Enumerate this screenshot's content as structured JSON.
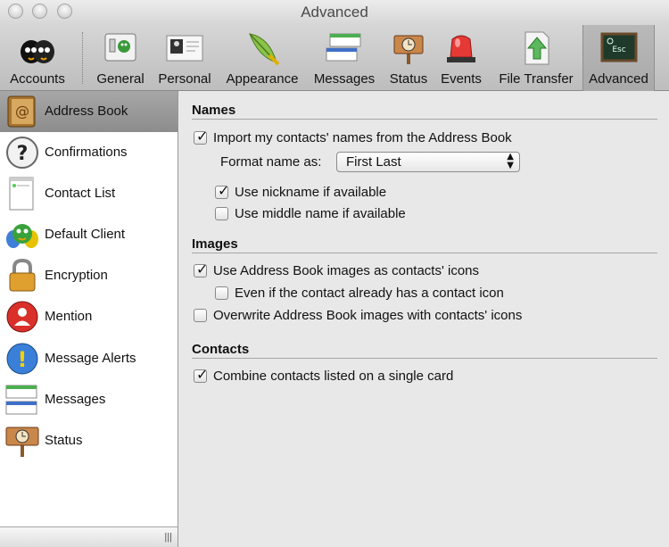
{
  "window": {
    "title": "Advanced"
  },
  "toolbar": {
    "items": [
      {
        "label": "Accounts",
        "icon": "accounts-icon"
      },
      {
        "label": "General",
        "icon": "general-icon"
      },
      {
        "label": "Personal",
        "icon": "personal-icon"
      },
      {
        "label": "Appearance",
        "icon": "appearance-icon"
      },
      {
        "label": "Messages",
        "icon": "messages-icon"
      },
      {
        "label": "Status",
        "icon": "status-icon"
      },
      {
        "label": "Events",
        "icon": "events-icon"
      },
      {
        "label": "File Transfer",
        "icon": "file-transfer-icon"
      },
      {
        "label": "Advanced",
        "icon": "advanced-icon",
        "selected": true
      }
    ]
  },
  "sidebar": {
    "items": [
      {
        "label": "Address Book",
        "icon": "address-book-icon",
        "selected": true
      },
      {
        "label": "Confirmations",
        "icon": "question-icon"
      },
      {
        "label": "Contact List",
        "icon": "contact-list-icon"
      },
      {
        "label": "Default Client",
        "icon": "default-client-icon"
      },
      {
        "label": "Encryption",
        "icon": "lock-icon"
      },
      {
        "label": "Mention",
        "icon": "mention-icon"
      },
      {
        "label": "Message Alerts",
        "icon": "alert-icon"
      },
      {
        "label": "Messages",
        "icon": "messages-icon"
      },
      {
        "label": "Status",
        "icon": "status-sign-icon"
      }
    ]
  },
  "sections": {
    "names": {
      "title": "Names",
      "import_contacts": {
        "label": "Import my contacts' names from the Address Book",
        "checked": true
      },
      "format_label": "Format name as:",
      "format_value": "First Last",
      "use_nickname": {
        "label": "Use nickname if available",
        "checked": true
      },
      "use_middle_name": {
        "label": "Use middle name if available",
        "checked": false
      }
    },
    "images": {
      "title": "Images",
      "use_images": {
        "label": "Use Address Book images as contacts' icons",
        "checked": true
      },
      "even_if": {
        "label": "Even if the contact already has a contact icon",
        "checked": false
      },
      "overwrite": {
        "label": "Overwrite Address Book images with contacts' icons",
        "checked": false
      }
    },
    "contacts": {
      "title": "Contacts",
      "combine": {
        "label": "Combine contacts listed on a single card",
        "checked": true
      }
    }
  },
  "colors": {
    "sidebar_selected": "#9a9a9a",
    "toolbar_bg": "#c8c8c8",
    "content_bg": "#e8e8e8"
  }
}
